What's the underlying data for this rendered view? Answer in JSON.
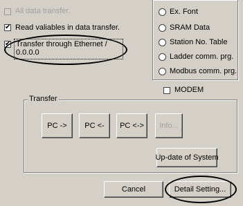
{
  "options": {
    "all_data_transfer": {
      "label": "All data transfer.",
      "checked": false,
      "enabled": false
    },
    "read_variables": {
      "label": "Read valiables in data transfer.",
      "checked": true
    },
    "transfer_ethernet": {
      "label_line1": "Transfer through Ethernet /",
      "label_line2": "0.0.0.0",
      "checked": true
    }
  },
  "radios": [
    {
      "label": "Ex. Font"
    },
    {
      "label": "SRAM Data"
    },
    {
      "label": "Station No. Table"
    },
    {
      "label": "Ladder comm. prg."
    },
    {
      "label": "Modbus comm. prg."
    }
  ],
  "modem": {
    "label": "MODEM",
    "checked": false
  },
  "transfer": {
    "group_label": "Transfer",
    "pc_to": "PC ->",
    "pc_from": "PC <-",
    "pc_compare": "PC <->",
    "info": "Info...",
    "update_system": "Up-date of System"
  },
  "footer": {
    "cancel": "Cancel",
    "detail_setting": "Detail Setting..."
  },
  "check_mark": "✔"
}
